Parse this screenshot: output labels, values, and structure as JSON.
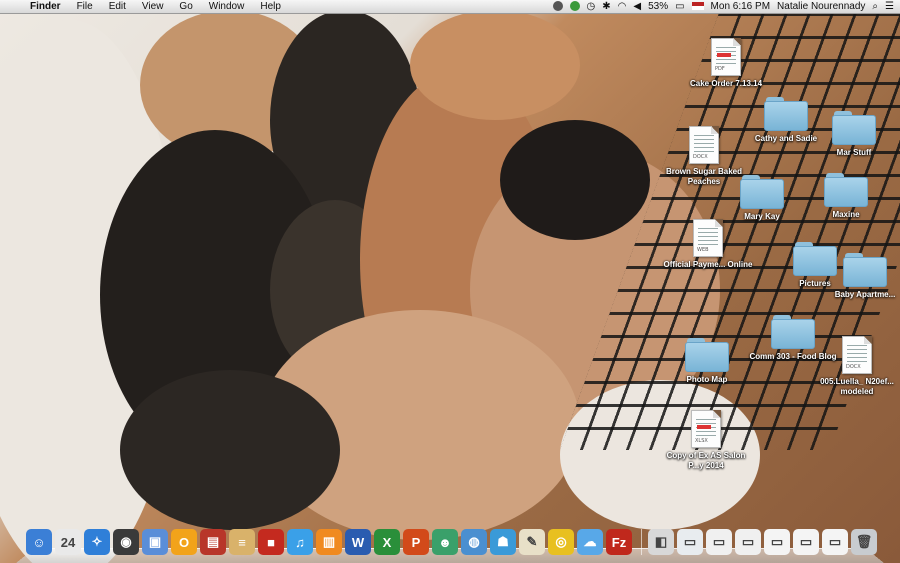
{
  "menubar": {
    "app_name": "Finder",
    "menus": [
      "File",
      "Edit",
      "View",
      "Go",
      "Window",
      "Help"
    ],
    "battery": "53%",
    "clock": "Mon 6:16 PM",
    "user": "Natalie Nourennady"
  },
  "desktop": {
    "icons": [
      {
        "label": "Cake Order 7.13.14",
        "kind": "doc-red",
        "tag": "PDF"
      },
      {
        "label": "Cathy and Sadie",
        "kind": "folder"
      },
      {
        "label": "Mar Stuff",
        "kind": "folder"
      },
      {
        "label": "Brown Sugar Baked Peaches",
        "kind": "doc",
        "tag": "DOCX"
      },
      {
        "label": "Mary Kay",
        "kind": "folder"
      },
      {
        "label": "Maxine",
        "kind": "folder"
      },
      {
        "label": "Official Payme... Online",
        "kind": "doc",
        "tag": "WEB"
      },
      {
        "label": "Pictures",
        "kind": "folder"
      },
      {
        "label": "Baby Apartme...",
        "kind": "folder"
      },
      {
        "label": "Comm 303 - Food Blog",
        "kind": "folder"
      },
      {
        "label": "Photo Map",
        "kind": "folder"
      },
      {
        "label": "005.Luella_ N20ef... modeled",
        "kind": "doc",
        "tag": "DOCX"
      },
      {
        "label": "Copy of Ex AS Salon P...y 2014",
        "kind": "doc-red",
        "tag": "XLSX"
      }
    ]
  },
  "dock": {
    "items": [
      {
        "name": "finder",
        "color": "#3b7fd6",
        "glyph": "☺"
      },
      {
        "name": "calendar",
        "color": "#e9e9e9",
        "glyph": "24"
      },
      {
        "name": "safari",
        "color": "#2f7fd8",
        "glyph": "✧"
      },
      {
        "name": "webcam",
        "color": "#3a3a3a",
        "glyph": "◉"
      },
      {
        "name": "preview",
        "color": "#5a8ed8",
        "glyph": "▣"
      },
      {
        "name": "outlook",
        "color": "#f2a31a",
        "glyph": "O"
      },
      {
        "name": "photo-booth",
        "color": "#b8362a",
        "glyph": "▤"
      },
      {
        "name": "notes",
        "color": "#d9b26a",
        "glyph": "≡"
      },
      {
        "name": "photobooth2",
        "color": "#c42a1f",
        "glyph": "■"
      },
      {
        "name": "itunes",
        "color": "#3aa0e8",
        "glyph": "♫"
      },
      {
        "name": "ibooks",
        "color": "#f08a20",
        "glyph": "▥"
      },
      {
        "name": "word",
        "color": "#2a5cb0",
        "glyph": "W"
      },
      {
        "name": "excel",
        "color": "#2a8f3a",
        "glyph": "X"
      },
      {
        "name": "powerpoint",
        "color": "#d24a1a",
        "glyph": "P"
      },
      {
        "name": "messenger",
        "color": "#3aa06a",
        "glyph": "☻"
      },
      {
        "name": "globe",
        "color": "#4a8fd0",
        "glyph": "◍"
      },
      {
        "name": "contacts",
        "color": "#3a9ad8",
        "glyph": "☗"
      },
      {
        "name": "textedit",
        "color": "#e8e0c8",
        "glyph": "✎"
      },
      {
        "name": "network",
        "color": "#e8c020",
        "glyph": "◎"
      },
      {
        "name": "chat",
        "color": "#58a8e8",
        "glyph": "☁"
      },
      {
        "name": "filezilla",
        "color": "#c0281c",
        "glyph": "Fz"
      }
    ],
    "docs": [
      {
        "name": "photo-stack",
        "color": "#d8d8d8",
        "glyph": "◧"
      },
      {
        "name": "downloads-1",
        "color": "#e8ecef",
        "glyph": "▭"
      },
      {
        "name": "downloads-2",
        "color": "#f0f0f0",
        "glyph": "▭"
      },
      {
        "name": "downloads-3",
        "color": "#f0f0f0",
        "glyph": "▭"
      },
      {
        "name": "downloads-4",
        "color": "#f4f4f4",
        "glyph": "▭"
      },
      {
        "name": "downloads-5",
        "color": "#f4f4f4",
        "glyph": "▭"
      },
      {
        "name": "downloads-6",
        "color": "#f4f4f4",
        "glyph": "▭"
      },
      {
        "name": "trash",
        "color": "#c8ccd0",
        "glyph": "🗑"
      }
    ]
  }
}
